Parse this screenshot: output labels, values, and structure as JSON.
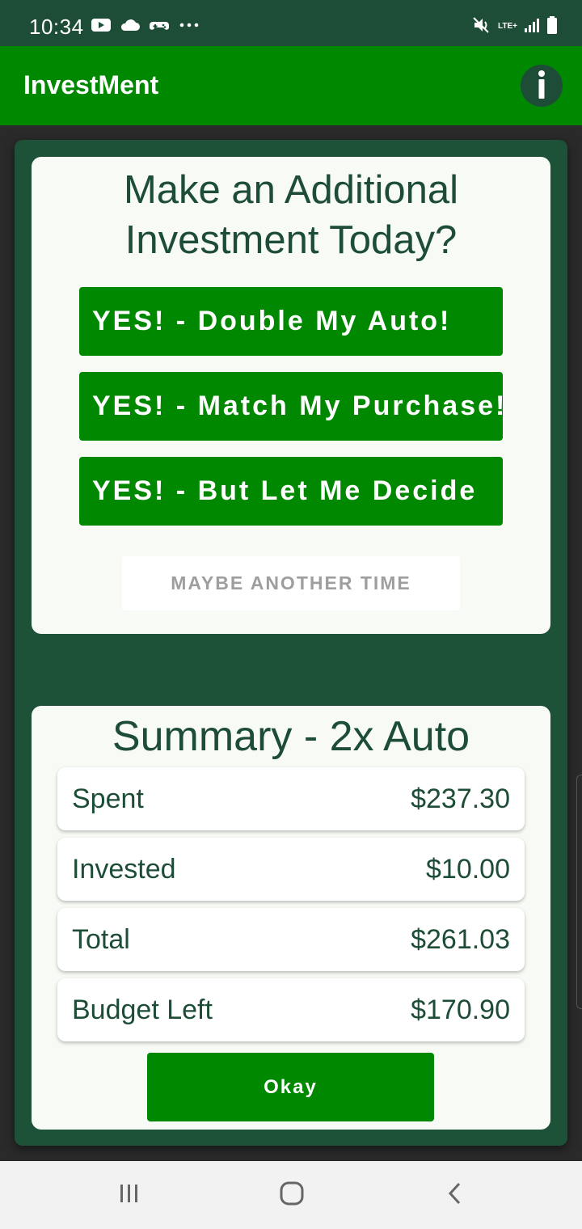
{
  "status_bar": {
    "time": "10:34",
    "network_label": "LTE+",
    "icons": [
      "youtube-icon",
      "cloud-icon",
      "game-controller-icon",
      "more-dots-icon",
      "mute-icon",
      "signal-icon",
      "battery-icon"
    ]
  },
  "app_bar": {
    "title": "InvestMent",
    "info_icon": "info-icon"
  },
  "invest_card": {
    "title": "Make an Additional Investment Today?",
    "buttons": [
      {
        "label": "YES! - Double My Auto!"
      },
      {
        "label": "YES! - Match My Purchase!"
      },
      {
        "label": "YES! - But Let Me Decide"
      }
    ],
    "maybe_label": "MAYBE ANOTHER TIME"
  },
  "summary_card": {
    "title": "Summary - 2x Auto",
    "rows": [
      {
        "label": "Spent",
        "value": "$237.30"
      },
      {
        "label": "Invested",
        "value": "$10.00"
      },
      {
        "label": "Total",
        "value": "$261.03"
      },
      {
        "label": "Budget Left",
        "value": "$170.90"
      }
    ],
    "okay_label": "Okay"
  },
  "nav_bar": {
    "icons": [
      "recent-apps-icon",
      "home-icon",
      "back-icon"
    ]
  },
  "colors": {
    "primary_green": "#008800",
    "dark_green": "#1d4d36",
    "card_background": "#f7faf5"
  }
}
